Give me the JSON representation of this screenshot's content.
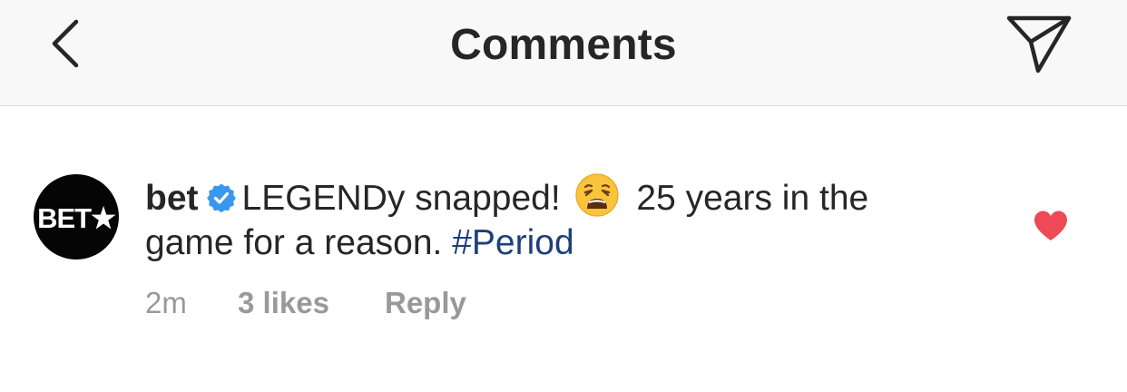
{
  "header": {
    "title": "Comments",
    "back_icon": "chevron-left-icon",
    "share_icon": "paper-plane-icon"
  },
  "comment": {
    "avatar_logo": "BET★",
    "username": "bet",
    "verified": true,
    "text_before_emoji": "LEGENDy snapped!",
    "emoji": "😩",
    "text_after_emoji": "25 years in the game for a reason.",
    "hashtag": "#Period",
    "time": "2m",
    "likes": "3 likes",
    "reply_label": "Reply",
    "liked": true
  },
  "colors": {
    "text": "#262626",
    "muted": "#999999",
    "hashtag": "#1f3f7a",
    "verified": "#3897f0",
    "heart": "#ed4956",
    "header_bg": "#f8f8f8"
  }
}
